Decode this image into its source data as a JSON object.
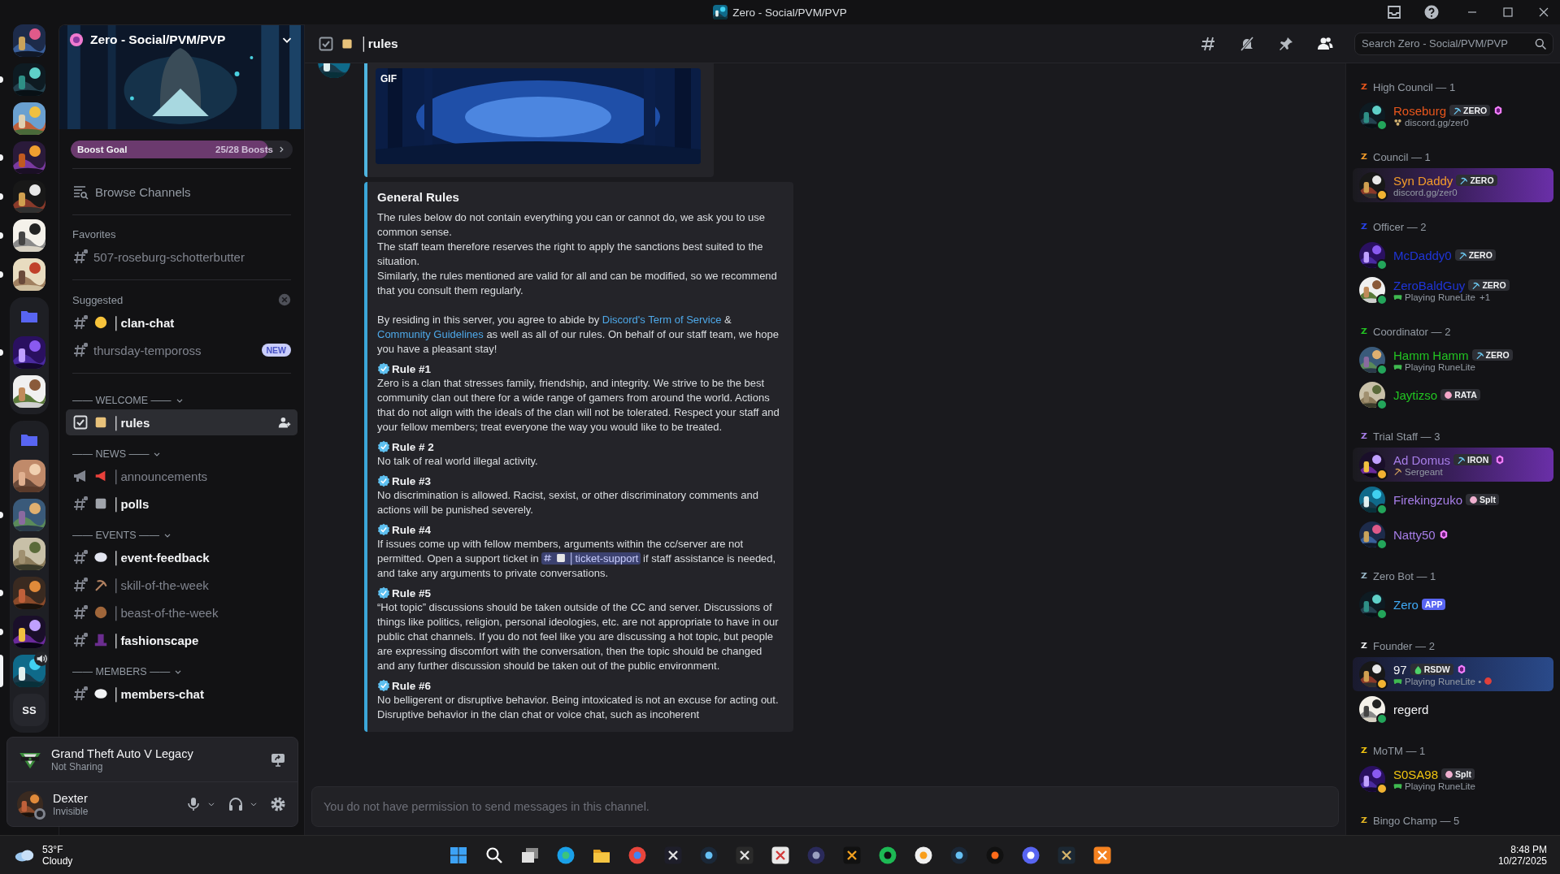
{
  "window": {
    "title": "Zero - Social/PVM/PVP"
  },
  "servers": [
    {
      "kind": "picture",
      "unread": false,
      "selected": false
    },
    {
      "kind": "picture",
      "unread": true,
      "selected": false
    },
    {
      "kind": "picture",
      "unread": false,
      "selected": false
    },
    {
      "kind": "picture",
      "unread": true,
      "selected": false
    },
    {
      "kind": "picture",
      "unread": true,
      "selected": false
    },
    {
      "kind": "picture",
      "unread": true,
      "selected": false
    },
    {
      "kind": "picture",
      "unread": true,
      "selected": false
    },
    {
      "kind": "folder",
      "items": [
        {
          "kind": "picture",
          "unread": true,
          "selected": false
        },
        {
          "kind": "picture",
          "unread": false,
          "selected": false
        }
      ]
    },
    {
      "kind": "folder",
      "items": [
        {
          "kind": "picture",
          "unread": false,
          "selected": false
        },
        {
          "kind": "picture",
          "unread": true,
          "selected": false
        },
        {
          "kind": "picture",
          "unread": false,
          "selected": false
        },
        {
          "kind": "picture",
          "unread": true,
          "selected": false
        },
        {
          "kind": "picture",
          "unread": true,
          "selected": false
        },
        {
          "kind": "picture",
          "unread": false,
          "selected": true,
          "voice": true
        },
        {
          "kind": "text",
          "label": "SS",
          "unread": false,
          "selected": false
        }
      ]
    }
  ],
  "channel_sidebar": {
    "server_name": "Zero - Social/PVM/PVP",
    "boost": {
      "label": "Boost Goal",
      "count": "25/28 Boosts",
      "level": 0.89
    },
    "browse_label": "Browse Channels",
    "sections": [
      {
        "kind": "favorites",
        "title": "Favorites",
        "channels": [
          {
            "name": "507-roseburg-schotterbutter",
            "kind": "text",
            "unread": false,
            "selected": false
          }
        ]
      },
      {
        "kind": "suggested",
        "title": "Suggested",
        "channels": [
          {
            "name": "│clan-chat",
            "kind": "text",
            "unread": true,
            "selected": false
          },
          {
            "name": "thursday-tempoross",
            "kind": "text",
            "unread": false,
            "selected": false,
            "badge": "NEW"
          }
        ]
      },
      {
        "kind": "category",
        "title": "—— WELCOME ——",
        "expanded": true,
        "channels": [
          {
            "name": "│rules",
            "kind": "rules",
            "unread": false,
            "selected": true
          }
        ]
      },
      {
        "kind": "category",
        "title": "—— NEWS ——",
        "expanded": true,
        "channels": [
          {
            "name": "│announcements",
            "kind": "announcement",
            "unread": false,
            "selected": false
          },
          {
            "name": "│polls",
            "kind": "text",
            "unread": true,
            "selected": false
          }
        ]
      },
      {
        "kind": "category",
        "title": "—— EVENTS ——",
        "expanded": true,
        "channels": [
          {
            "name": "│event-feedback",
            "kind": "text",
            "unread": true,
            "selected": false
          },
          {
            "name": "│skill-of-the-week",
            "kind": "text",
            "unread": false,
            "selected": false
          },
          {
            "name": "│beast-of-the-week",
            "kind": "text",
            "unread": false,
            "selected": false
          },
          {
            "name": "│fashionscape",
            "kind": "text",
            "unread": true,
            "selected": false
          }
        ]
      },
      {
        "kind": "category",
        "title": "—— MEMBERS ——",
        "expanded": true,
        "channels": [
          {
            "name": "│members-chat",
            "kind": "text",
            "unread": true,
            "selected": false
          }
        ]
      }
    ]
  },
  "user_panel": {
    "activity": {
      "title": "Grand Theft Auto V Legacy",
      "status": "Not Sharing"
    },
    "user": {
      "name": "Dexter",
      "status_text": "Invisible",
      "invisible": true
    }
  },
  "chat": {
    "header": {
      "channel": "│rules",
      "kind": "rules"
    },
    "search": {
      "placeholder": "Search Zero - Social/PVM/PVP"
    },
    "gif_embed": {
      "badge": "GIF"
    },
    "embed": {
      "title": "General Rules",
      "intro": [
        "The rules below do not contain everything you can or cannot do, we ask you to use common sense.",
        "The staff team therefore reserves the right to apply the sanctions best suited to the situation.",
        "Similarly, the rules mentioned are valid for all and can be modified, so we recommend that you consult them regularly."
      ],
      "closing": [
        {
          "kind": "text",
          "text": "By residing in this server, you agree to abide by "
        },
        {
          "kind": "link",
          "text": "Discord's Term of Service"
        },
        {
          "kind": "text",
          "text": " & "
        },
        {
          "kind": "link",
          "text": "Community Guidelines"
        },
        {
          "kind": "text",
          "text": " as well as all of our rules. On behalf of our staff team, we hope you have a pleasant stay!"
        }
      ],
      "rules": [
        {
          "title": "Rule #1",
          "parts": [
            {
              "kind": "text",
              "text": "Zero is a clan that stresses family, friendship, and integrity. We strive to be the best community clan out there for a wide range of gamers from around the world. Actions that do not align with the ideals of the clan will not be tolerated. Respect your staff and your fellow members; treat everyone the way you would like to be treated."
            }
          ]
        },
        {
          "title": "Rule # 2",
          "parts": [
            {
              "kind": "text",
              "text": "No talk of real world illegal activity."
            }
          ]
        },
        {
          "title": "Rule #3",
          "parts": [
            {
              "kind": "text",
              "text": "No discrimination is allowed. Racist, sexist, or other discriminatory comments and actions will be punished severely."
            }
          ]
        },
        {
          "title": "Rule #4",
          "parts": [
            {
              "kind": "text",
              "text": "If issues come up with fellow members, arguments within the cc/server are not permitted. Open a support ticket in "
            },
            {
              "kind": "mention",
              "text": "│ticket-support"
            },
            {
              "kind": "text",
              "text": " if staff assistance is needed, and take any arguments to private conversations."
            }
          ]
        },
        {
          "title": "Rule #5",
          "parts": [
            {
              "kind": "text",
              "text": "“Hot topic” discussions should be taken outside of the CC and server. Discussions of things like politics, religion, personal ideologies, etc. are not appropriate to have in our public chat channels. If you do not feel like you are discussing a hot topic, but people are expressing discomfort with the conversation, then the topic should be changed and any further discussion should be taken out of the public environment."
            }
          ]
        },
        {
          "title": "Rule #6",
          "parts": [
            {
              "kind": "text",
              "text": "No belligerent or disruptive behavior. Being intoxicated is not an excuse for acting out. Disruptive behavior in the clan chat or voice chat, such as incoherent"
            }
          ]
        }
      ]
    },
    "composer_notice": "You do not have permission to send messages in this channel."
  },
  "members": [
    {
      "title": "High Council — 1",
      "color": "#e8561c",
      "members": [
        {
          "name": "Roseburg",
          "color": "#e8561c",
          "idle": false,
          "booster": true,
          "highlight": false,
          "tag": {
            "kind": "guild",
            "text": "ZERO"
          },
          "activity": {
            "kind": "custom",
            "text": "discord.gg/zer0"
          }
        }
      ]
    },
    {
      "title": "Council — 1",
      "color": "#f39c2a",
      "members": [
        {
          "name": "Syn Daddy",
          "color": "#f39c2a",
          "idle": true,
          "booster": false,
          "highlight": true,
          "tag": {
            "kind": "guild",
            "text": "ZERO"
          },
          "activity": {
            "kind": "plain",
            "text": "discord.gg/zer0"
          }
        }
      ]
    },
    {
      "title": "Officer — 2",
      "color": "#2742e8",
      "members": [
        {
          "name": "McDaddy0",
          "color": "#1f35d8",
          "idle": false,
          "booster": false,
          "highlight": false,
          "tag": {
            "kind": "guild",
            "text": "ZERO"
          }
        },
        {
          "name": "ZeroBaldGuy",
          "color": "#1f35d8",
          "idle": false,
          "booster": false,
          "highlight": false,
          "tag": {
            "kind": "guild",
            "text": "ZERO"
          },
          "activity": {
            "kind": "playing",
            "text": "Playing RuneLite",
            "extra": "+1"
          }
        }
      ]
    },
    {
      "title": "Coordinator — 2",
      "color": "#22c422",
      "members": [
        {
          "name": "Hamm Hamm",
          "color": "#22c422",
          "idle": false,
          "booster": false,
          "highlight": false,
          "tag": {
            "kind": "guild",
            "text": "ZERO"
          },
          "activity": {
            "kind": "playing",
            "text": "Playing RuneLite"
          }
        },
        {
          "name": "Jaytizso",
          "color": "#22c422",
          "idle": false,
          "booster": false,
          "highlight": false,
          "tag": {
            "kind": "guild",
            "text": "RATA"
          }
        }
      ]
    },
    {
      "title": "Trial Staff — 3",
      "color": "#a77ee8",
      "members": [
        {
          "name": "Ad Domus",
          "color": "#a77ee8",
          "idle": true,
          "booster": true,
          "highlight": true,
          "tag": {
            "kind": "guild",
            "text": "IRON"
          },
          "activity": {
            "kind": "custom",
            "text": "Sergeant"
          }
        },
        {
          "name": "Firekingzuko",
          "color": "#a77ee8",
          "idle": false,
          "booster": false,
          "highlight": false,
          "tag": {
            "kind": "guild",
            "text": "Splt"
          }
        },
        {
          "name": "Natty50",
          "color": "#a77ee8",
          "idle": false,
          "booster": true,
          "highlight": false
        }
      ]
    },
    {
      "title": "Zero Bot — 1",
      "color": "#9ab8c8",
      "members": [
        {
          "name": "Zero",
          "color": "#3fa9f5",
          "idle": false,
          "booster": false,
          "highlight": false,
          "tag": {
            "kind": "bot",
            "text": "APP"
          }
        }
      ]
    },
    {
      "title": "Founder — 2",
      "color": "#f2f3f5",
      "members": [
        {
          "name": "97",
          "color": "#f2f3f5",
          "idle": true,
          "booster": true,
          "highlight": true,
          "tag": {
            "kind": "guild",
            "text": "RSDW"
          },
          "activity": {
            "kind": "playing_emoji",
            "text": "Playing RuneLite •"
          }
        },
        {
          "name": "regerd",
          "color": "#f2f3f5",
          "idle": false,
          "booster": false,
          "highlight": false
        }
      ]
    },
    {
      "title": "MoTM — 1",
      "color": "#f1c40f",
      "members": [
        {
          "name": "S0SA98",
          "color": "#f1c40f",
          "idle": true,
          "booster": false,
          "highlight": false,
          "tag": {
            "kind": "guild",
            "text": "Splt"
          },
          "activity": {
            "kind": "playing",
            "text": "Playing RuneLite"
          }
        }
      ]
    },
    {
      "title": "Bingo Champ — 5",
      "color": "#e8b923"
    }
  ],
  "taskbar": {
    "weather": {
      "temp": "53°F",
      "condition": "Cloudy"
    },
    "time": "8:48 PM",
    "date": "10/27/2025"
  }
}
